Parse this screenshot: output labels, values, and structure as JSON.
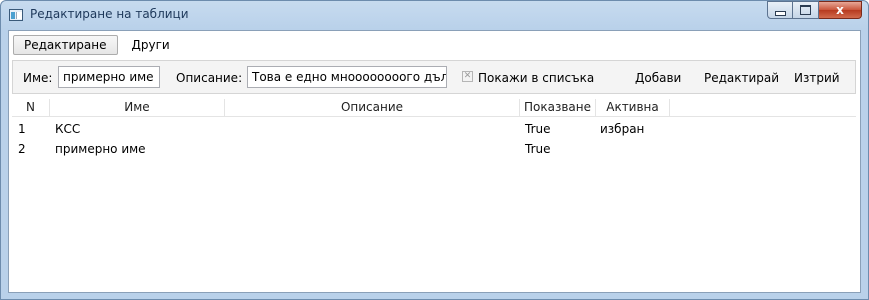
{
  "window": {
    "title": "Редактиране на таблици",
    "controls": {
      "close_glyph": "x"
    }
  },
  "tabs": [
    {
      "label": "Редактиране",
      "active": true
    },
    {
      "label": "Други",
      "active": false
    }
  ],
  "form": {
    "name_label": "Име:",
    "name_value": "примерно име",
    "description_label": "Описание:",
    "description_value": "Това е едно мноооооооого дълго о",
    "show_in_list_label": "Покажи в списъка",
    "show_in_list_checked": true,
    "add_label": "Добави",
    "edit_label": "Редактирай",
    "delete_label": "Изтрий"
  },
  "grid": {
    "columns": [
      "N",
      "Име",
      "Описание",
      "Показване",
      "Активна"
    ],
    "rows": [
      {
        "n": "1",
        "name": "КСС",
        "description": "",
        "shown": "True",
        "active": "избран"
      },
      {
        "n": "2",
        "name": "примерно име",
        "description": "",
        "shown": "True",
        "active": ""
      }
    ]
  }
}
